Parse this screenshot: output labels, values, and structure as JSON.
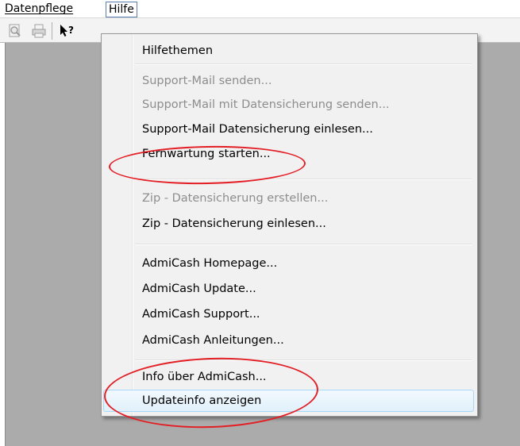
{
  "menubar": {
    "items": [
      {
        "label": "Datenpflege",
        "mnemonic": "D"
      },
      {
        "label": "Hilfe",
        "mnemonic": "H"
      }
    ]
  },
  "toolbar": {
    "icons": [
      "print-preview-icon",
      "print-icon",
      "context-help-icon"
    ]
  },
  "dropdown": {
    "items": [
      {
        "label": "Hilfethemen",
        "enabled": true
      },
      {
        "label": "Support-Mail senden...",
        "enabled": false
      },
      {
        "label": "Support-Mail mit Datensicherung senden...",
        "enabled": false
      },
      {
        "label": "Support-Mail Datensicherung einlesen...",
        "enabled": true
      },
      {
        "label": "Fernwartung starten...",
        "enabled": true
      },
      {
        "label": "Zip - Datensicherung erstellen...",
        "enabled": false
      },
      {
        "label": "Zip - Datensicherung einlesen...",
        "enabled": true
      },
      {
        "label": "AdmiCash Homepage...",
        "enabled": true
      },
      {
        "label": "AdmiCash Update...",
        "enabled": true
      },
      {
        "label": "AdmiCash Support...",
        "enabled": true
      },
      {
        "label": "AdmiCash Anleitungen...",
        "enabled": true
      },
      {
        "label": "Info über AdmiCash...",
        "enabled": true
      },
      {
        "label": "Updateinfo anzeigen",
        "enabled": true,
        "hovered": true
      }
    ]
  },
  "colors": {
    "annotation": "#e31e24",
    "hover": "#e1f0fb",
    "workspace": "#ababab",
    "disabled_text": "#8d8d8d"
  }
}
